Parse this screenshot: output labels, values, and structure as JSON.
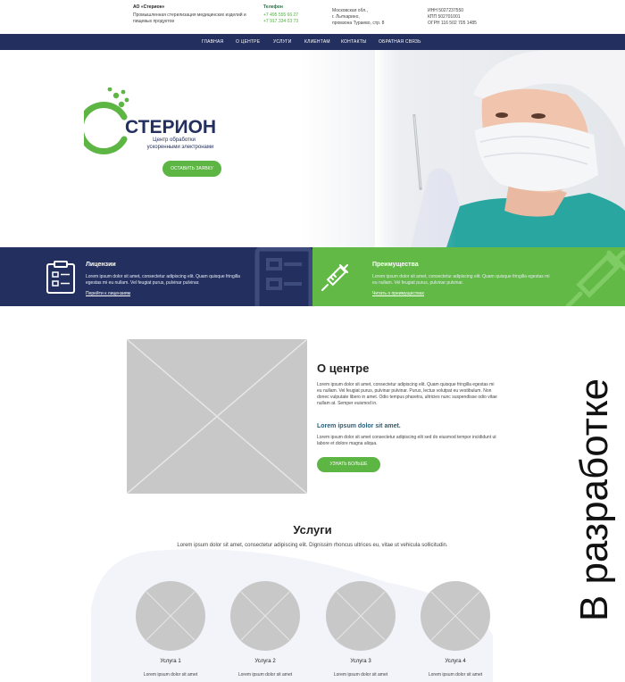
{
  "topbar": {
    "company": "АО «Стерион»",
    "company_desc": "Промышленная стерилизация медицинских изделий и пищевых продуктов",
    "phone_head": "Телефон",
    "phone1": "+7 495 555 66 27",
    "phone2": "+7 917 334 03 73",
    "addr1": "Московская обл.,",
    "addr2": "г. Лыткарино,",
    "addr3": "промзона Тураево, стр. 8",
    "inn": "ИНН 5027237550",
    "kpp": "КПП 502701001",
    "ogrn": "ОГРН 116 502 705 1485"
  },
  "nav": {
    "items": [
      "ГЛАВНАЯ",
      "О ЦЕНТРЕ",
      "УСЛУГИ",
      "КЛИЕНТАМ",
      "КОНТАКТЫ",
      "ОБРАТНАЯ СВЯЗЬ"
    ]
  },
  "hero": {
    "logo_name": "СТЕРИОН",
    "logo_tag1": "Центр обработки",
    "logo_tag2": "ускоренными электронами",
    "button": "ОСТАВИТЬ ЗАЯВКУ"
  },
  "panels": {
    "left": {
      "title": "Лицензии",
      "text": "Lorem ipsum dolor sit amet, consectetur adipiscing elit. Quam quisque fringilla egestas mi eu nullam. Vel feugiat purus, pulvinar pulvinar.",
      "link": "Перейти к лицензиям"
    },
    "right": {
      "title": "Преимущества",
      "text": "Lorem ipsum dolor sit amet, consectetur adipiscing elit. Quam quisque fringilla egestas mi eu nullam. Vel feugiat purus, pulvinar pulvinar.",
      "link": "Читать о преимуществах"
    }
  },
  "about": {
    "title": "О центре",
    "text": "Lorem ipsum dolor sit amet, consectetur adipiscing elit. Quam quisque fringilla egestas mi eu nullam. Vel feugiat purus, pulvinar pulvinar. Purus, lectus volutpat eu vestibulum. Non donec vulputate libero in amet. Odio tempus pharetra, ultricies nunc suspendisse odio vitae nullam at. Semper euismod in.",
    "subtitle": "Lorem ipsum dolor sit amet.",
    "text2": "Lorem ipsum dolor sit amet consectetur adipiscing elit sed do eiusmod tempor incididunt ut labore et dolore magna aliqua.",
    "button": "УЗНАТЬ БОЛЬШЕ"
  },
  "services": {
    "title": "Услуги",
    "subtitle": "Lorem ipsum dolor sit amet, consectetur adipiscing elit. Dignissim rhoncus ultrices eu, vitae ut vehicula sollicitudin.",
    "items": [
      {
        "label": "Услуга 1",
        "desc": "Lorem ipsum dolor sit amet"
      },
      {
        "label": "Услуга 2",
        "desc": "Lorem ipsum dolor sit amet"
      },
      {
        "label": "Услуга 3",
        "desc": "Lorem ipsum dolor sit amet"
      },
      {
        "label": "Услуга 4",
        "desc": "Lorem ipsum dolor sit amet"
      }
    ]
  },
  "overlay": {
    "label": "В разработке"
  },
  "colors": {
    "navy": "#23305f",
    "green": "#5db544",
    "placeholder": "#c8c8c8"
  }
}
